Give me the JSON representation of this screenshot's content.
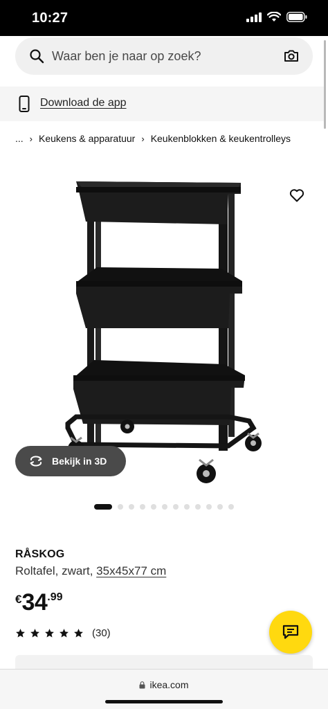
{
  "status_bar": {
    "time": "10:27"
  },
  "search": {
    "placeholder": "Waar ben je naar op zoek?"
  },
  "app_banner": {
    "link_text": "Download de app"
  },
  "breadcrumb": {
    "ellipsis": "...",
    "items": [
      "Keukens & apparatuur",
      "Keukenblokken & keukentrolleys"
    ]
  },
  "gallery": {
    "view_3d_label": "Bekijk in 3D",
    "total_slides": 12,
    "active_slide": 1
  },
  "product": {
    "name": "RÅSKOG",
    "description": "Roltafel, zwart,",
    "size": "35x45x77 cm",
    "price": {
      "currency": "€",
      "integer": "34",
      "decimal": ".99"
    },
    "rating": {
      "stars": 5,
      "count": "(30)"
    }
  },
  "browser": {
    "url": "ikea.com"
  },
  "icons": {
    "search": "search-icon",
    "camera": "camera-icon",
    "phone": "phone-icon",
    "favorite": "heart-icon",
    "view_3d": "rotate-3d-icon",
    "chat": "chat-icon",
    "lock": "lock-icon",
    "star": "star-icon"
  },
  "colors": {
    "chat_button": "#ffd90f",
    "view_3d_button": "#4a4a4a",
    "banner_bg": "#f5f5f5"
  }
}
